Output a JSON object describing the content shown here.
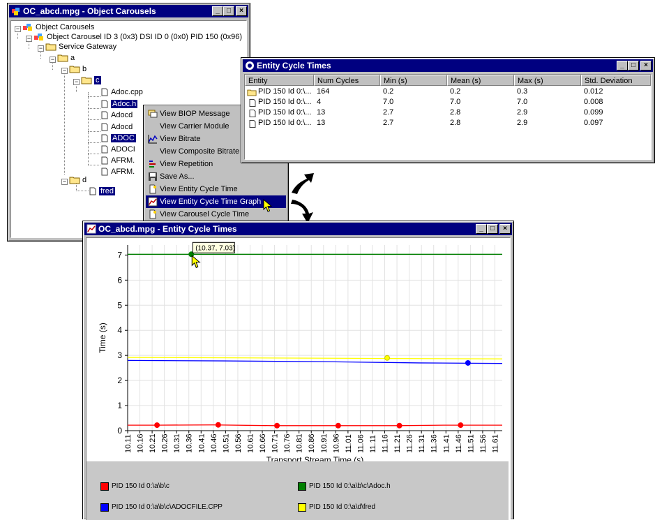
{
  "carousel_window": {
    "title": "OC_abcd.mpg - Object Carousels",
    "tree": {
      "root": "Object Carousels",
      "carousel": "Object Carousel ID 3 (0x3) DSI ID 0 (0x0) PID 150 (0x96)",
      "gateway": "Service Gateway",
      "dir_a": "a",
      "dir_b": "b",
      "dir_c": "c",
      "files_c": [
        "Adoc.cpp",
        "Adoc.h",
        "Adocd",
        "Adocd",
        "ADOC",
        "ADOCI",
        "AFRM.",
        "AFRM."
      ],
      "dir_d": "d",
      "file_d": "fred"
    }
  },
  "context_menu": {
    "items": [
      {
        "label": "View BIOP Message",
        "icon": "biop-message-icon"
      },
      {
        "label": "View Carrier Module",
        "icon": ""
      },
      {
        "label": "View Bitrate",
        "icon": "bitrate-icon"
      },
      {
        "label": "View Composite Bitrate",
        "icon": ""
      },
      {
        "label": "View Repetition",
        "icon": "repetition-icon"
      },
      {
        "label": "Save As...",
        "icon": "save-icon"
      },
      {
        "label": "View Entity Cycle Time",
        "icon": "entity-cycle-time-icon"
      },
      {
        "label": "View Entity Cycle Time Graph",
        "icon": "entity-cycle-graph-icon"
      },
      {
        "label": "View Carousel Cycle Time",
        "icon": "carousel-cycle-time-icon"
      }
    ],
    "highlighted_index": 7
  },
  "entity_window": {
    "title": "Entity Cycle Times",
    "columns": [
      "Entity",
      "Num Cycles",
      "Min (s)",
      "Mean (s)",
      "Max (s)",
      "Std. Deviation"
    ],
    "rows": [
      {
        "icon": "folder-icon",
        "entity": "PID 150 Id 0:\\...",
        "num_cycles": "164",
        "min": "0.2",
        "mean": "0.2",
        "max": "0.3",
        "std": "0.012"
      },
      {
        "icon": "file-icon",
        "entity": "PID 150 Id 0:\\...",
        "num_cycles": "4",
        "min": "7.0",
        "mean": "7.0",
        "max": "7.0",
        "std": "0.008"
      },
      {
        "icon": "file-icon",
        "entity": "PID 150 Id 0:\\...",
        "num_cycles": "13",
        "min": "2.7",
        "mean": "2.8",
        "max": "2.9",
        "std": "0.099"
      },
      {
        "icon": "file-icon",
        "entity": "PID 150 Id 0:\\...",
        "num_cycles": "13",
        "min": "2.7",
        "mean": "2.8",
        "max": "2.9",
        "std": "0.097"
      }
    ]
  },
  "graph_window": {
    "title": "OC_abcd.mpg - Entity Cycle Times",
    "tooltip": "(10.37, 7.03)"
  },
  "chart_data": {
    "type": "line",
    "xlabel": "Transport Stream Time (s)",
    "ylabel": "Time (s)",
    "xlim": [
      10.11,
      11.64
    ],
    "ylim": [
      0,
      7.4
    ],
    "x_ticks": [
      "10.11",
      "10.16",
      "10.21",
      "10.26",
      "10.31",
      "10.36",
      "10.41",
      "10.46",
      "10.51",
      "10.56",
      "10.61",
      "10.66",
      "10.71",
      "10.76",
      "10.81",
      "10.86",
      "10.91",
      "10.96",
      "11.01",
      "11.06",
      "11.11",
      "11.16",
      "11.21",
      "11.26",
      "11.31",
      "11.36",
      "11.41",
      "11.46",
      "11.51",
      "11.56",
      "11.61"
    ],
    "y_ticks": [
      "0",
      "1",
      "2",
      "3",
      "4",
      "5",
      "6",
      "7"
    ],
    "grid": true,
    "legend_position": "bottom",
    "series": [
      {
        "name": "PID 150 Id 0:\\a\\b\\c",
        "color": "#ff0000",
        "x": [
          10.11,
          10.23,
          10.46,
          10.71,
          10.96,
          11.21,
          11.41,
          11.64
        ],
        "y": [
          0.22,
          0.22,
          0.23,
          0.2,
          0.2,
          0.2,
          0.22,
          0.22
        ],
        "markers_x": [
          10.23,
          10.48,
          10.72,
          10.97,
          11.22,
          11.47
        ],
        "markers_y": [
          0.22,
          0.23,
          0.2,
          0.2,
          0.2,
          0.22
        ]
      },
      {
        "name": "PID 150 Id 0:\\a\\b\\c\\Adoc.h",
        "color": "#008000",
        "x": [
          10.11,
          11.64
        ],
        "y": [
          7.03,
          7.03
        ],
        "markers_x": [
          10.37
        ],
        "markers_y": [
          7.03
        ]
      },
      {
        "name": "PID 150 Id 0:\\a\\b\\c\\ADOCFILE.CPP",
        "color": "#0000ff",
        "x": [
          10.11,
          10.5,
          10.9,
          11.3,
          11.64
        ],
        "y": [
          2.8,
          2.78,
          2.75,
          2.7,
          2.68
        ],
        "markers_x": [
          11.5
        ],
        "markers_y": [
          2.7
        ]
      },
      {
        "name": "PID 150 Id 0:\\a\\d\\fred",
        "color": "#ffff00",
        "x": [
          10.11,
          10.6,
          11.1,
          11.64
        ],
        "y": [
          2.92,
          2.9,
          2.88,
          2.86
        ],
        "markers_x": [
          11.17
        ],
        "markers_y": [
          2.9
        ]
      }
    ]
  }
}
